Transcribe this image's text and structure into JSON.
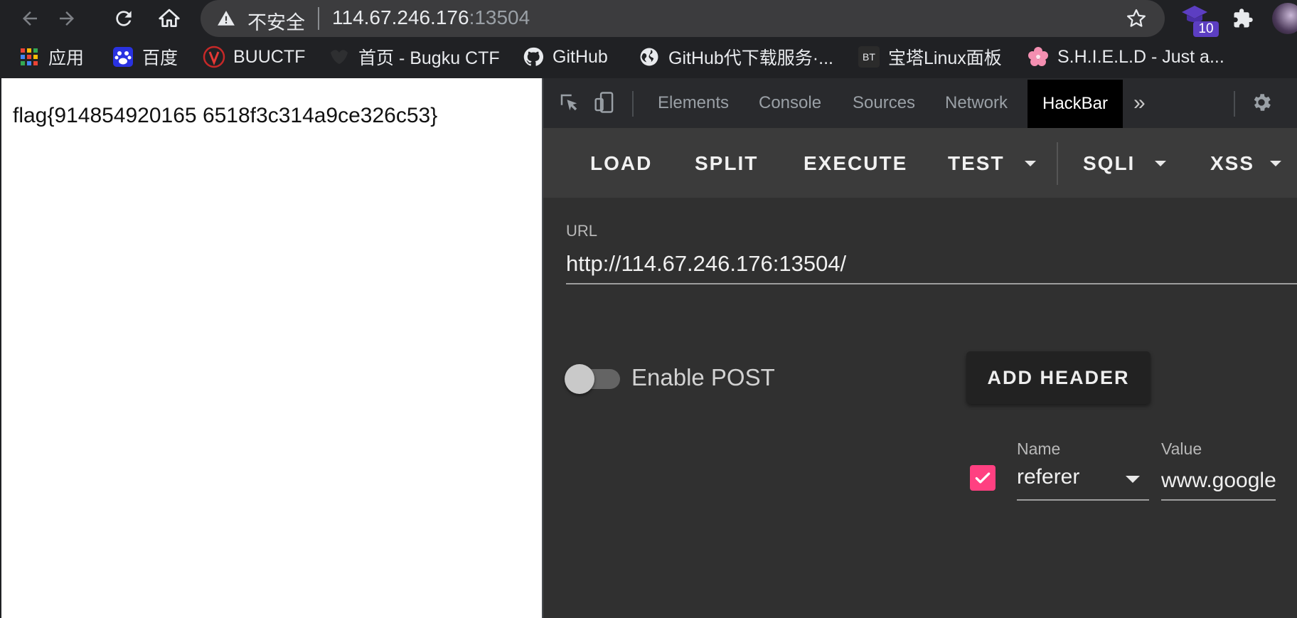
{
  "browser": {
    "security_label": "不安全",
    "url_host": "114.67.246.176",
    "url_port": ":13504",
    "extension_badge": "10"
  },
  "bookmarks": [
    {
      "label": "应用",
      "icon": "apps-grid-icon"
    },
    {
      "label": "百度",
      "icon": "baidu-paw-icon"
    },
    {
      "label": "BUUCTF",
      "icon": "buuctf-icon"
    },
    {
      "label": "首页 - Bugku CTF",
      "icon": "bugku-icon"
    },
    {
      "label": "GitHub",
      "icon": "github-icon"
    },
    {
      "label": "GitHub代下载服务·...",
      "icon": "globe-icon"
    },
    {
      "label": "宝塔Linux面板",
      "icon": "bt-icon"
    },
    {
      "label": "S.H.I.E.L.D - Just a...",
      "icon": "flower-icon"
    }
  ],
  "page": {
    "content": "flag{914854920165 6518f3c314a9ce326c53}"
  },
  "devtools": {
    "tabs": [
      "Elements",
      "Console",
      "Sources",
      "Network",
      "HackBar"
    ],
    "active_tab": "HackBar",
    "more_symbol": "»"
  },
  "hackbar": {
    "toolbar": [
      "LOAD",
      "SPLIT",
      "EXECUTE",
      "TEST",
      "SQLI",
      "XSS"
    ],
    "url_label": "URL",
    "url_value": "http://114.67.246.176:13504/",
    "enable_post_label": "Enable POST",
    "enable_post": false,
    "add_header_label": "ADD HEADER",
    "header": {
      "enabled": true,
      "name_label": "Name",
      "value_label": "Value",
      "name": "referer",
      "value": "www.google.com"
    },
    "accent_color": "#ff4081"
  }
}
